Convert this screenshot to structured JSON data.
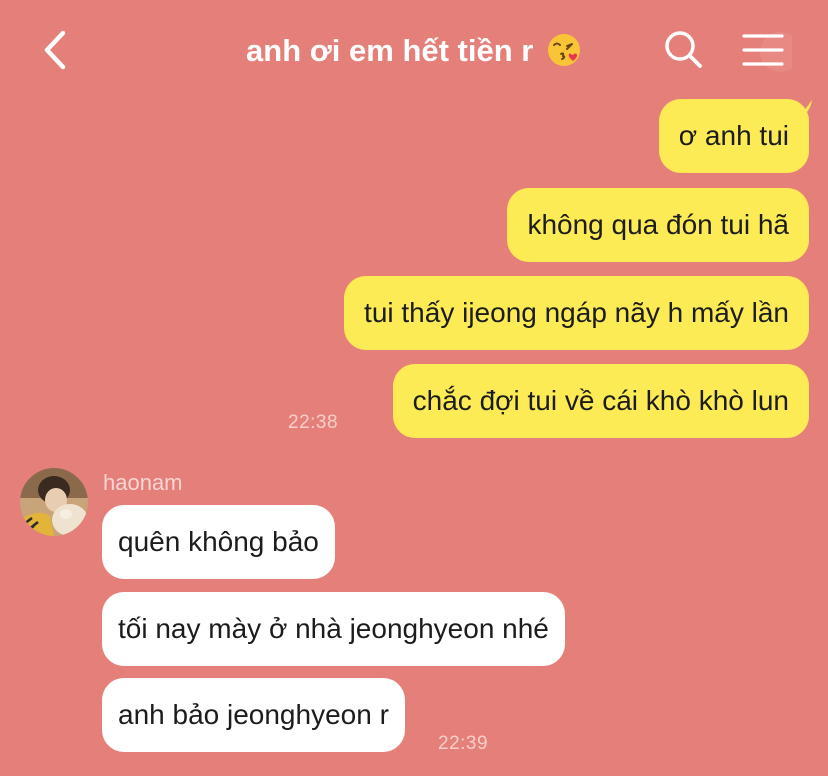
{
  "header": {
    "title": "anh ơi em hết tiền r",
    "back_icon": "chevron-left-icon",
    "search_icon": "search-icon",
    "menu_icon": "hamburger-menu-icon",
    "title_emoji": "face-blowing-kiss-emoji"
  },
  "colors": {
    "background": "#e57f7a",
    "outgoing_bubble": "#fdeb55",
    "incoming_bubble": "#ffffff",
    "timestamp": "#f6cfcb"
  },
  "outgoing": {
    "messages": [
      "ơ anh tui",
      "không qua đón tui hã",
      "tui thấy ijeong ngáp nãy h mấy lần",
      "chắc đợi tui về cái khò khò lun"
    ],
    "time": "22:38"
  },
  "incoming": {
    "sender": "haonam",
    "messages": [
      "quên không bảo",
      "tối nay mày ở nhà jeonghyeon nhé",
      "anh bảo jeonghyeon r"
    ],
    "time": "22:39"
  }
}
